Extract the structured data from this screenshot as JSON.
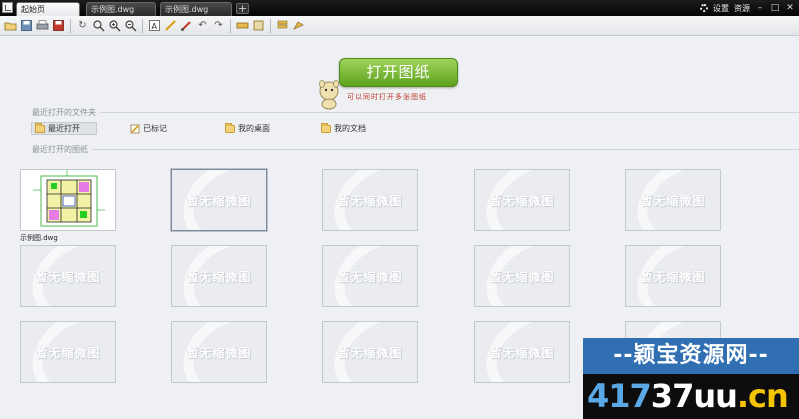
{
  "tabs": [
    {
      "label": "起始页",
      "active": true
    },
    {
      "label": "示例图.dwg",
      "active": false
    },
    {
      "label": "示例图.dwg",
      "active": false
    }
  ],
  "title_right": {
    "settings": "设置",
    "resource": "资源"
  },
  "toolbar_icons": [
    "open-icon",
    "save-icon",
    "print-icon",
    "save-as-icon",
    "rotate-icon",
    "zoom-icon",
    "zoom-in-icon",
    "zoom-out-icon",
    "text-icon",
    "pencil-icon",
    "brush-icon",
    "undo-icon",
    "redo-icon",
    "measure-icon",
    "area-icon",
    "layers-icon",
    "share-icon"
  ],
  "open_button": {
    "label": "打开图纸",
    "slogan": "可以同时打开多张图纸"
  },
  "sections": {
    "folders": "最近打开的文件夹",
    "drawings": "最近打开的图纸"
  },
  "folders": [
    {
      "label": "最近打开",
      "icon": "folder-icon",
      "selected": true
    },
    {
      "label": "已标记",
      "icon": "pencil-icon",
      "selected": false
    },
    {
      "label": "我的桌面",
      "icon": "folder-icon",
      "selected": false
    },
    {
      "label": "我的文档",
      "icon": "folder-icon",
      "selected": false
    }
  ],
  "thumbnails": {
    "placeholder": "暂无缩微图",
    "first_caption": "示例图.dwg"
  },
  "watermark": {
    "line1": "--颖宝资源网--",
    "line2a": "417",
    "line2b": "37uu",
    "line2c": ".cn"
  },
  "colors": {
    "accent_green": "#6cb02a",
    "watermark_blue": "#2f6fb2",
    "watermark_yellow": "#f5c400"
  }
}
